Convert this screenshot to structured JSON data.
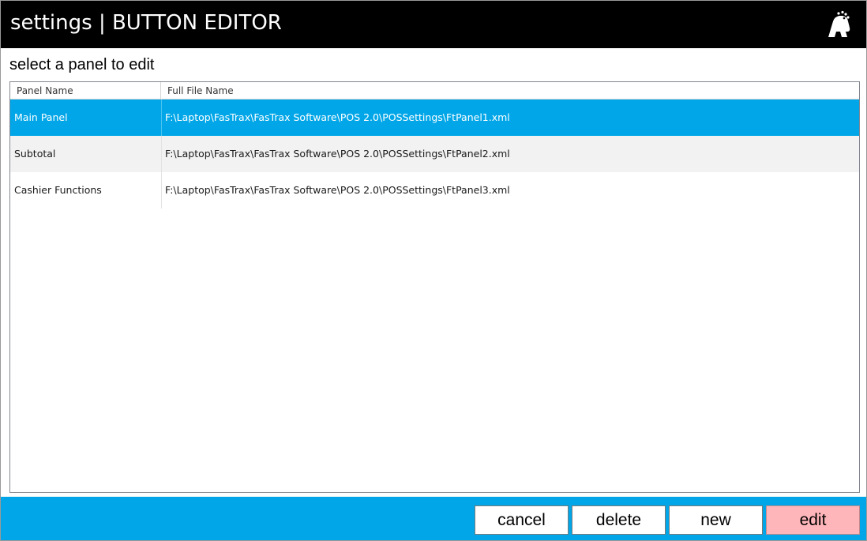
{
  "window": {
    "title": "settings | BUTTON EDITOR",
    "logo_icon": "fastrax-logo-icon"
  },
  "page": {
    "subtitle": "select a panel to edit"
  },
  "grid": {
    "columns": [
      "Panel Name",
      "Full File Name"
    ],
    "rows": [
      {
        "name": "Main Panel",
        "file": "F:\\Laptop\\FasTrax\\FasTrax Software\\POS 2.0\\POSSettings\\FtPanel1.xml",
        "selected": true
      },
      {
        "name": "Subtotal",
        "file": "F:\\Laptop\\FasTrax\\FasTrax Software\\POS 2.0\\POSSettings\\FtPanel2.xml",
        "selected": false
      },
      {
        "name": "Cashier Functions",
        "file": "F:\\Laptop\\FasTrax\\FasTrax Software\\POS 2.0\\POSSettings\\FtPanel3.xml",
        "selected": false
      }
    ]
  },
  "actions": {
    "cancel_label": "cancel",
    "delete_label": "delete",
    "new_label": "new",
    "edit_label": "edit"
  },
  "colors": {
    "title_bar": "#000000",
    "accent": "#00a6e8",
    "edit_button": "#ffb6ba",
    "alt_row": "#f2f2f2"
  }
}
